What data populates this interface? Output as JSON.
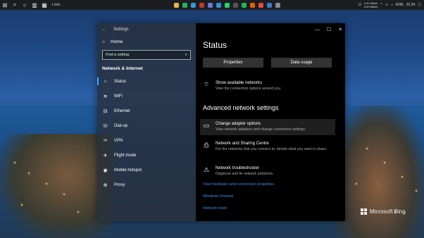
{
  "taskbar": {
    "search_text": "Links",
    "apps": [
      {
        "name": "explorer",
        "color": "#e8b84a"
      },
      {
        "name": "spotify",
        "color": "#1db954"
      },
      {
        "name": "edge",
        "color": "#2f9be0"
      },
      {
        "name": "app-red",
        "color": "#c0392b"
      },
      {
        "name": "photos",
        "color": "#6a7bd6"
      },
      {
        "name": "vscode",
        "color": "#2d8fe0"
      },
      {
        "name": "whatsapp",
        "color": "#25d366"
      },
      {
        "name": "camera",
        "color": "#555"
      },
      {
        "name": "spotify2",
        "color": "#1db954"
      },
      {
        "name": "firefox",
        "color": "#e66000"
      },
      {
        "name": "chrome",
        "color": "#e74c3c"
      },
      {
        "name": "app-blue",
        "color": "#3a7bd5"
      },
      {
        "name": "settings",
        "color": "#8a8a8a"
      }
    ],
    "tray": {
      "net_up": "0.00 Mbit/s",
      "net_down": "0.00 Mbit/s",
      "lang": "ENG",
      "time": "21:24"
    }
  },
  "window": {
    "title": "Settings",
    "home": "Home",
    "search_placeholder": "Find a setting",
    "section": "Network & Internet",
    "nav": [
      {
        "label": "Status",
        "icon": "status",
        "active": true
      },
      {
        "label": "WiFi",
        "icon": "wifi"
      },
      {
        "label": "Ethernet",
        "icon": "ethernet"
      },
      {
        "label": "Dial-up",
        "icon": "dialup"
      },
      {
        "label": "VPN",
        "icon": "vpn"
      },
      {
        "label": "Flight mode",
        "icon": "flight"
      },
      {
        "label": "Mobile hotspot",
        "icon": "hotspot"
      },
      {
        "label": "Proxy",
        "icon": "proxy"
      }
    ]
  },
  "main": {
    "title": "Status",
    "btn_properties": "Properties",
    "btn_data_usage": "Data usage",
    "show_networks": {
      "title": "Show available networks",
      "desc": "View the connection options around you."
    },
    "advanced_heading": "Advanced network settings",
    "adapter": {
      "title": "Change adapter options",
      "desc": "View network adapters and change connection settings."
    },
    "sharing": {
      "title": "Network and Sharing Centre",
      "desc": "For the networks that you connect to, decide what you want to share."
    },
    "troubleshooter": {
      "title": "Network troubleshooter",
      "desc": "Diagnose and fix network problems."
    },
    "links": [
      "View hardware and connection properties",
      "Windows Firewall",
      "Network reset"
    ]
  },
  "watermark": "Microsoft Bing"
}
